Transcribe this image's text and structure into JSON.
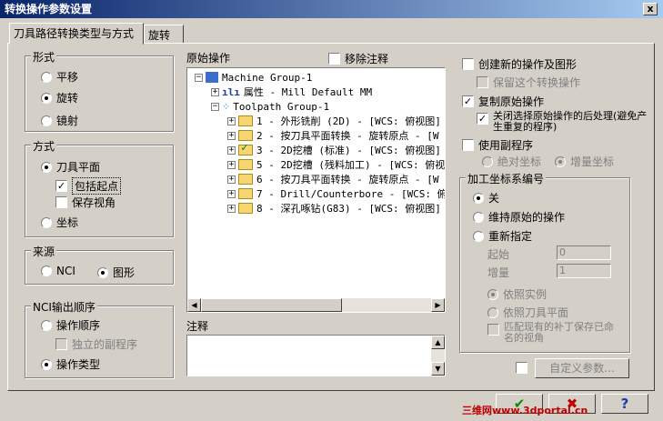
{
  "window": {
    "title": "转换操作参数设置",
    "close_label": "x"
  },
  "tabs": [
    {
      "label": "刀具路径转换类型与方式"
    },
    {
      "label": "旋转"
    }
  ],
  "style_group": {
    "label": "形式",
    "options": [
      "平移",
      "旋转",
      "镜射"
    ],
    "selected": 1
  },
  "method_group": {
    "label": "方式",
    "plane_label": "刀具平面",
    "include_origin_label": "包括起点",
    "keep_view_label": "保存视角",
    "coord_label": "坐标"
  },
  "source_group": {
    "label": "来源",
    "nci_label": "NCI",
    "geometry_label": "图形"
  },
  "nci_order_group": {
    "label": "NCI输出顺序",
    "op_order_label": "操作顺序",
    "subprogram_label": "独立的副程序",
    "op_type_label": "操作类型"
  },
  "ops_tree": {
    "label": "原始操作",
    "remove_comment_label": "移除注释",
    "root": "Machine Group-1",
    "properties": "属性 - Mill Default MM",
    "toolpath_group": "Toolpath Group-1",
    "items": [
      {
        "text": "1 - 外形铣削 (2D) - [WCS: 俯视图]",
        "checked": false
      },
      {
        "text": "2 - 按刀具平面转换 - 旋转原点 - [W",
        "checked": false
      },
      {
        "text": "3 - 2D挖槽 (标准) - [WCS: 俯视图]",
        "checked": true
      },
      {
        "text": "5 - 2D挖槽 (残料加工) - [WCS: 俯视",
        "checked": false
      },
      {
        "text": "6 - 按刀具平面转换 - 旋转原点 - [W",
        "checked": false
      },
      {
        "text": "7 - Drill/Counterbore - [WCS: 俯视",
        "checked": false
      },
      {
        "text": "8 - 深孔啄钻(G83) - [WCS: 俯视图]",
        "checked": false
      }
    ]
  },
  "notes": {
    "label": "注释"
  },
  "options": {
    "create_new_label": "创建新的操作及图形",
    "keep_transform_label": "保留这个转换操作",
    "copy_original_label": "复制原始操作",
    "disable_post_label": "关闭选择原始操作的后处理(避免产生重复的程序)",
    "use_subprogram_label": "使用副程序",
    "absolute_label": "绝对坐标",
    "incremental_label": "增量坐标"
  },
  "work_offset_group": {
    "label": "加工坐标系编号",
    "off_label": "关",
    "keep_original_label": "维持原始的操作",
    "reassign_label": "重新指定",
    "start_label": "起始",
    "start_value": "0",
    "increment_label": "增量",
    "increment_value": "1",
    "by_instance_label": "依照实例",
    "by_plane_label": "依照刀具平面",
    "match_existing_label": "匹配现有的补丁保存已命名的视角"
  },
  "custom_params_label": "自定义参数...",
  "footer": {
    "watermark": "三维网www.3dportal.cn"
  }
}
